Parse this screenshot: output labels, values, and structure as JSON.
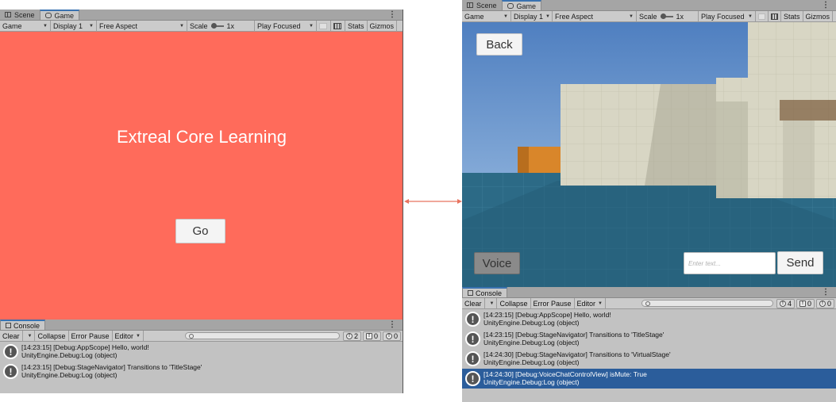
{
  "colors": {
    "title_stage_bg": "#ff6b5b",
    "selected_row": "#2b5d9b",
    "connector": "#e8735f",
    "sky": "#6a9cd4",
    "floor": "#2c6a86"
  },
  "left_window": {
    "tabs": [
      {
        "label": "Scene",
        "icon": "scene-icon"
      },
      {
        "label": "Game",
        "icon": "gamepad-icon"
      }
    ],
    "toolbar": {
      "mode": "Game",
      "display": "Display 1",
      "aspect": "Free Aspect",
      "scale_label": "Scale",
      "scale_value": "1x",
      "play_mode": "Play Focused",
      "stats": "Stats",
      "gizmos": "Gizmos"
    },
    "game_view": {
      "title": "Extreal Core Learning",
      "go_label": "Go"
    },
    "console": {
      "tab": "Console",
      "clear": "Clear",
      "collapse": "Collapse",
      "error_pause": "Error Pause",
      "editor": "Editor",
      "counts": {
        "info": "2",
        "warn": "0",
        "error": "0"
      },
      "logs": [
        {
          "line1": "[14:23:15] [Debug:AppScope] Hello, world!",
          "line2": "UnityEngine.Debug:Log (object)"
        },
        {
          "line1": "[14:23:15] [Debug:StageNavigator] Transitions to 'TitleStage'",
          "line2": "UnityEngine.Debug:Log (object)"
        }
      ]
    }
  },
  "right_window": {
    "tabs": [
      {
        "label": "Scene",
        "icon": "scene-icon"
      },
      {
        "label": "Game",
        "icon": "gamepad-icon"
      }
    ],
    "toolbar": {
      "mode": "Game",
      "display": "Display 1",
      "aspect": "Free Aspect",
      "scale_label": "Scale",
      "scale_value": "1x",
      "play_mode": "Play Focused",
      "stats": "Stats",
      "gizmos": "Gizmos"
    },
    "game_view": {
      "back_label": "Back",
      "voice_label": "Voice",
      "input_placeholder": "Enter text...",
      "send_label": "Send"
    },
    "console": {
      "tab": "Console",
      "clear": "Clear",
      "collapse": "Collapse",
      "error_pause": "Error Pause",
      "editor": "Editor",
      "counts": {
        "info": "4",
        "warn": "0",
        "error": "0"
      },
      "logs": [
        {
          "line1": "[14:23:15] [Debug:AppScope] Hello, world!",
          "line2": "UnityEngine.Debug:Log (object)"
        },
        {
          "line1": "[14:23:15] [Debug:StageNavigator] Transitions to 'TitleStage'",
          "line2": "UnityEngine.Debug:Log (object)"
        },
        {
          "line1": "[14:24:30] [Debug:StageNavigator] Transitions to 'VirtualStage'",
          "line2": "UnityEngine.Debug:Log (object)"
        },
        {
          "line1": "[14:24:30] [Debug:VoiceChatControlView] isMute: True",
          "line2": "UnityEngine.Debug:Log (object)",
          "selected": true
        }
      ]
    }
  }
}
